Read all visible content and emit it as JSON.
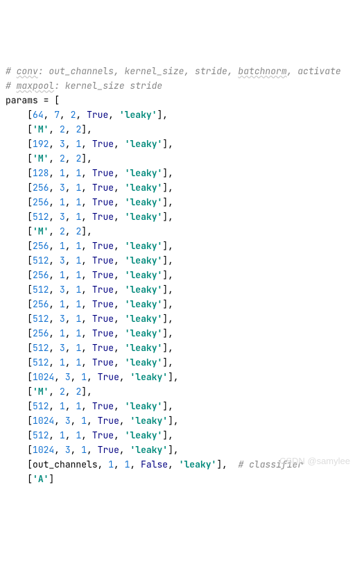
{
  "comment1_pre": "# ",
  "comment1_underline": "conv",
  "comment1_mid": ": out_channels, kernel_size, stride, ",
  "comment1_underline2": "batchnorm",
  "comment1_post": ", activate",
  "comment2_pre": "# ",
  "comment2_underline": "maxpool",
  "comment2_post": ": kernel_size stride",
  "assign": "params = [",
  "rows": [
    {
      "pre": "    [",
      "v0": "64",
      "c0": ", ",
      "v1": "7",
      "c1": ", ",
      "v2": "2",
      "c2": ", ",
      "v3": "True",
      "c3": ", ",
      "v4": "'leaky'",
      "post": "],"
    },
    {
      "pre": "    [",
      "v0": "'M'",
      "c0": ", ",
      "v1": "2",
      "c1": ", ",
      "v2": "2",
      "post": "],"
    },
    {
      "pre": "    [",
      "v0": "192",
      "c0": ", ",
      "v1": "3",
      "c1": ", ",
      "v2": "1",
      "c2": ", ",
      "v3": "True",
      "c3": ", ",
      "v4": "'leaky'",
      "post": "],"
    },
    {
      "pre": "    [",
      "v0": "'M'",
      "c0": ", ",
      "v1": "2",
      "c1": ", ",
      "v2": "2",
      "post": "],"
    },
    {
      "pre": "    [",
      "v0": "128",
      "c0": ", ",
      "v1": "1",
      "c1": ", ",
      "v2": "1",
      "c2": ", ",
      "v3": "True",
      "c3": ", ",
      "v4": "'leaky'",
      "post": "],"
    },
    {
      "pre": "    [",
      "v0": "256",
      "c0": ", ",
      "v1": "3",
      "c1": ", ",
      "v2": "1",
      "c2": ", ",
      "v3": "True",
      "c3": ", ",
      "v4": "'leaky'",
      "post": "],"
    },
    {
      "pre": "    [",
      "v0": "256",
      "c0": ", ",
      "v1": "1",
      "c1": ", ",
      "v2": "1",
      "c2": ", ",
      "v3": "True",
      "c3": ", ",
      "v4": "'leaky'",
      "post": "],"
    },
    {
      "pre": "    [",
      "v0": "512",
      "c0": ", ",
      "v1": "3",
      "c1": ", ",
      "v2": "1",
      "c2": ", ",
      "v3": "True",
      "c3": ", ",
      "v4": "'leaky'",
      "post": "],"
    },
    {
      "pre": "    [",
      "v0": "'M'",
      "c0": ", ",
      "v1": "2",
      "c1": ", ",
      "v2": "2",
      "post": "],"
    },
    {
      "pre": "    [",
      "v0": "256",
      "c0": ", ",
      "v1": "1",
      "c1": ", ",
      "v2": "1",
      "c2": ", ",
      "v3": "True",
      "c3": ", ",
      "v4": "'leaky'",
      "post": "],"
    },
    {
      "pre": "    [",
      "v0": "512",
      "c0": ", ",
      "v1": "3",
      "c1": ", ",
      "v2": "1",
      "c2": ", ",
      "v3": "True",
      "c3": ", ",
      "v4": "'leaky'",
      "post": "],"
    },
    {
      "pre": "    [",
      "v0": "256",
      "c0": ", ",
      "v1": "1",
      "c1": ", ",
      "v2": "1",
      "c2": ", ",
      "v3": "True",
      "c3": ", ",
      "v4": "'leaky'",
      "post": "],"
    },
    {
      "pre": "    [",
      "v0": "512",
      "c0": ", ",
      "v1": "3",
      "c1": ", ",
      "v2": "1",
      "c2": ", ",
      "v3": "True",
      "c3": ", ",
      "v4": "'leaky'",
      "post": "],"
    },
    {
      "pre": "    [",
      "v0": "256",
      "c0": ", ",
      "v1": "1",
      "c1": ", ",
      "v2": "1",
      "c2": ", ",
      "v3": "True",
      "c3": ", ",
      "v4": "'leaky'",
      "post": "],"
    },
    {
      "pre": "    [",
      "v0": "512",
      "c0": ", ",
      "v1": "3",
      "c1": ", ",
      "v2": "1",
      "c2": ", ",
      "v3": "True",
      "c3": ", ",
      "v4": "'leaky'",
      "post": "],"
    },
    {
      "pre": "    [",
      "v0": "256",
      "c0": ", ",
      "v1": "1",
      "c1": ", ",
      "v2": "1",
      "c2": ", ",
      "v3": "True",
      "c3": ", ",
      "v4": "'leaky'",
      "post": "],"
    },
    {
      "pre": "    [",
      "v0": "512",
      "c0": ", ",
      "v1": "3",
      "c1": ", ",
      "v2": "1",
      "c2": ", ",
      "v3": "True",
      "c3": ", ",
      "v4": "'leaky'",
      "post": "],"
    },
    {
      "pre": "    [",
      "v0": "512",
      "c0": ", ",
      "v1": "1",
      "c1": ", ",
      "v2": "1",
      "c2": ", ",
      "v3": "True",
      "c3": ", ",
      "v4": "'leaky'",
      "post": "],"
    },
    {
      "pre": "    [",
      "v0": "1024",
      "c0": ", ",
      "v1": "3",
      "c1": ", ",
      "v2": "1",
      "c2": ", ",
      "v3": "True",
      "c3": ", ",
      "v4": "'leaky'",
      "post": "],"
    },
    {
      "pre": "    [",
      "v0": "'M'",
      "c0": ", ",
      "v1": "2",
      "c1": ", ",
      "v2": "2",
      "post": "],"
    },
    {
      "pre": "    [",
      "v0": "512",
      "c0": ", ",
      "v1": "1",
      "c1": ", ",
      "v2": "1",
      "c2": ", ",
      "v3": "True",
      "c3": ", ",
      "v4": "'leaky'",
      "post": "],"
    },
    {
      "pre": "    [",
      "v0": "1024",
      "c0": ", ",
      "v1": "3",
      "c1": ", ",
      "v2": "1",
      "c2": ", ",
      "v3": "True",
      "c3": ", ",
      "v4": "'leaky'",
      "post": "],"
    },
    {
      "pre": "    [",
      "v0": "512",
      "c0": ", ",
      "v1": "1",
      "c1": ", ",
      "v2": "1",
      "c2": ", ",
      "v3": "True",
      "c3": ", ",
      "v4": "'leaky'",
      "post": "],"
    },
    {
      "pre": "    [",
      "v0": "1024",
      "c0": ", ",
      "v1": "3",
      "c1": ", ",
      "v2": "1",
      "c2": ", ",
      "v3": "True",
      "c3": ", ",
      "v4": "'leaky'",
      "post": "],"
    },
    {
      "pre": "    [",
      "v0": "out_channels",
      "c0": ", ",
      "v1": "1",
      "c1": ", ",
      "v2": "1",
      "c2": ", ",
      "v3": "False",
      "c3": ", ",
      "v4": "'leaky'",
      "post": "],  ",
      "trail": "# classifier"
    },
    {
      "pre": "    [",
      "v0": "'A'",
      "post": "]"
    }
  ],
  "close": "]",
  "watermark": "CSDN @samylee"
}
